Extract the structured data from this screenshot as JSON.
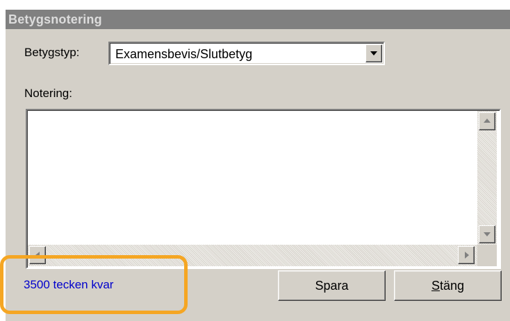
{
  "dialog": {
    "title": "Betygsnotering"
  },
  "grade_type": {
    "label": "Betygstyp:",
    "selected": "Examensbevis/Slutbetyg"
  },
  "note": {
    "label": "Notering:",
    "value": ""
  },
  "status": {
    "chars_left": "3500 tecken kvar"
  },
  "buttons": {
    "save": "Spara",
    "close": "Stäng"
  },
  "colors": {
    "panel_bg": "#d4d0c8",
    "title_bar": "#808080",
    "status_text": "#0000cc",
    "highlight": "#f5a623"
  },
  "icons": {
    "dropdown": "chevron-down-icon",
    "scroll_up": "arrow-up-icon",
    "scroll_down": "arrow-down-icon",
    "scroll_left": "arrow-left-icon",
    "scroll_right": "arrow-right-icon"
  }
}
